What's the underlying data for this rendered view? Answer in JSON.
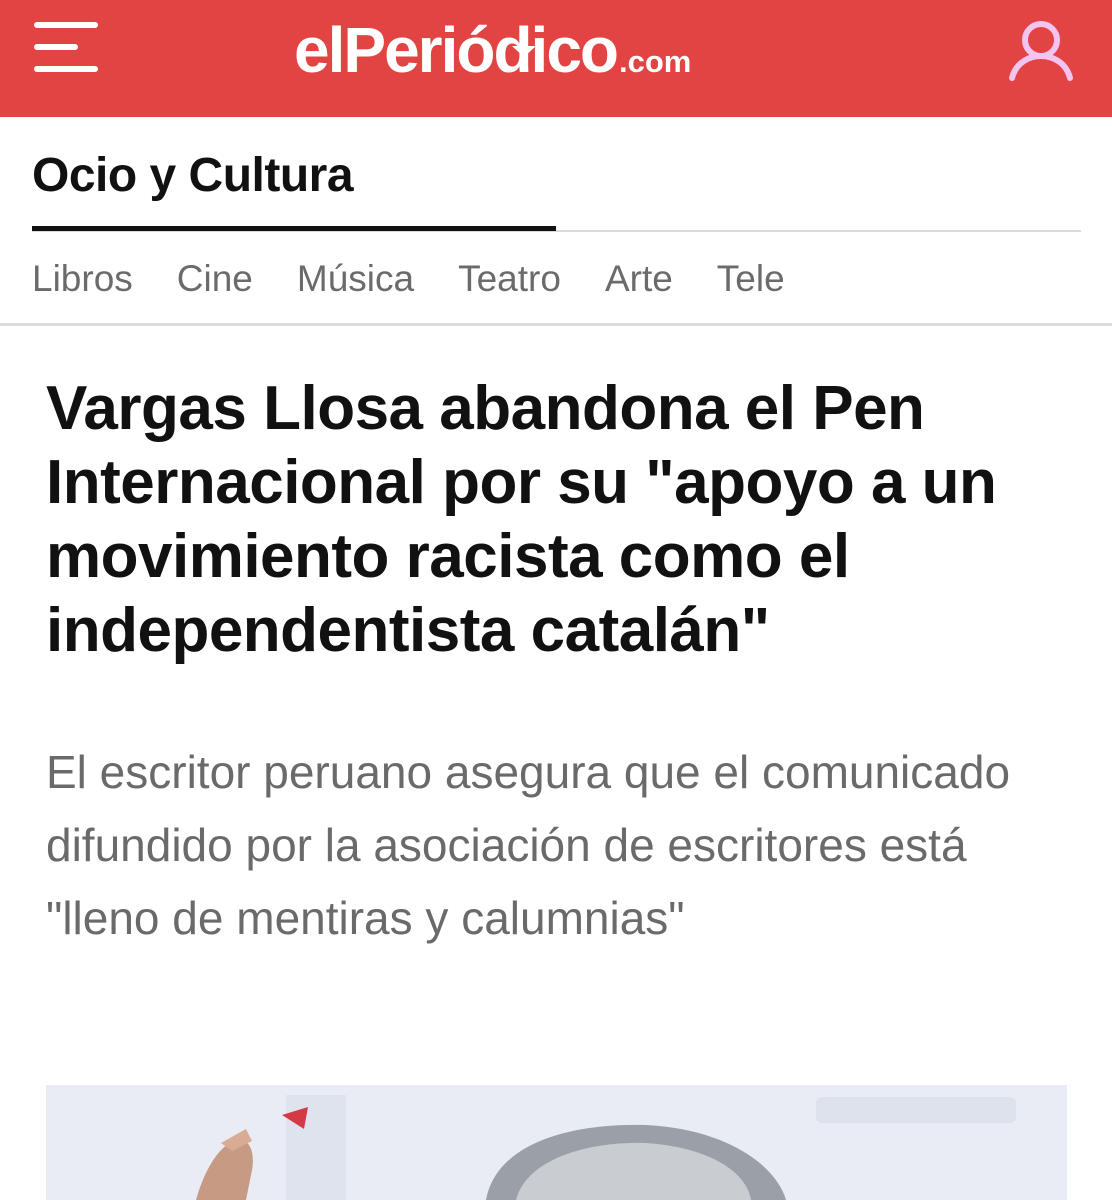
{
  "header": {
    "logo_main": "elPeriódico",
    "logo_tld": ".com",
    "brand_color": "#e24444",
    "menu_icon": "hamburger-menu-icon",
    "user_icon": "user-icon"
  },
  "section": {
    "title": "Ocio y Cultura",
    "subnav": [
      "Libros",
      "Cine",
      "Música",
      "Teatro",
      "Arte",
      "Tele"
    ]
  },
  "article": {
    "headline": "Vargas Llosa abandona el Pen Internacional por su \"apoyo a un movimiento racista como el independentista catalán\"",
    "subtitle": "El escritor peruano asegura que el comunicado difundido por la asociación de escritores está \"lleno de mentiras y calumnias\""
  }
}
